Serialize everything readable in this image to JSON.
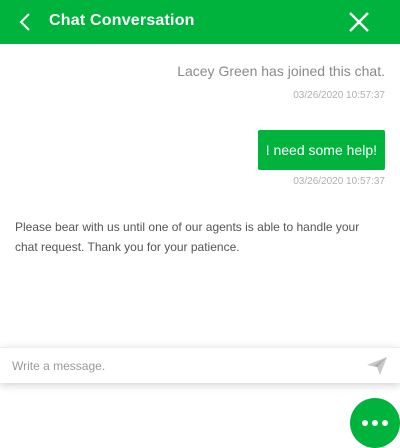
{
  "header": {
    "title": "Chat Conversation",
    "back_icon": "chevron-left-icon",
    "close_icon": "close-icon",
    "color": "#00b33c"
  },
  "messages": {
    "system": {
      "text": "Lacey Green has joined this chat.",
      "timestamp": "03/26/2020 10:57:37"
    },
    "user": {
      "text": "I need some help!",
      "timestamp": "03/26/2020 10:57:37"
    },
    "agent": {
      "text": "Please bear with us until one of our agents is able to handle your chat request. Thank you for your patience."
    }
  },
  "composer": {
    "placeholder": "Write a message.",
    "value": "",
    "send_icon": "send-icon"
  },
  "fab": {
    "icon": "more-dots-icon"
  },
  "colors": {
    "accent": "#00b33c",
    "muted_text": "#8a8a8a",
    "timestamp": "#b0b0b0"
  }
}
